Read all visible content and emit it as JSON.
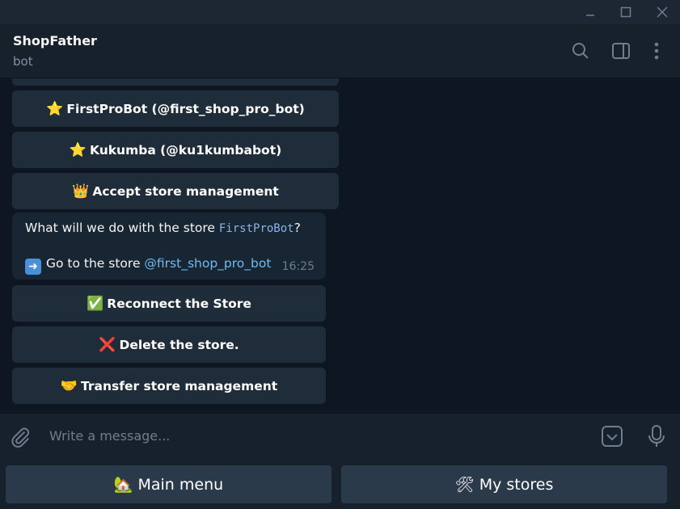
{
  "window": {
    "controls": [
      "minimize-icon",
      "maximize-icon",
      "close-icon"
    ]
  },
  "header": {
    "title": "ShopFather",
    "status": "bot",
    "icons": [
      "search-icon",
      "sidebar-toggle-icon",
      "more-vertical-icon"
    ]
  },
  "keyboard_top": [
    {
      "emoji": "⭐",
      "label": "FirstProBot (@first_shop_pro_bot)"
    },
    {
      "emoji": "⭐",
      "label": "Kukumba (@ku1kumbabot)"
    },
    {
      "emoji": "👑",
      "label": "Accept store management"
    }
  ],
  "message": {
    "text_before": "What will we do with the store ",
    "store_code": "FirstProBot",
    "text_after": "?",
    "goto_prefix": "Go to the store ",
    "goto_link": "@first_shop_pro_bot",
    "time": "16:25"
  },
  "keyboard_bottom": [
    {
      "emoji": "✅",
      "label": "Reconnect the Store"
    },
    {
      "emoji": "❌",
      "label": "Delete the store."
    },
    {
      "emoji": "🤝",
      "label": "Transfer store management"
    }
  ],
  "composer": {
    "placeholder": "Write a message..."
  },
  "reply_keyboard": [
    {
      "emoji": "🏡",
      "label": "Main menu"
    },
    {
      "emoji": "🛠",
      "label": "My stores"
    }
  ],
  "colors": {
    "background": "#0e1621",
    "header": "#17212b",
    "button": "#1f2c39",
    "link": "#71baf2"
  }
}
